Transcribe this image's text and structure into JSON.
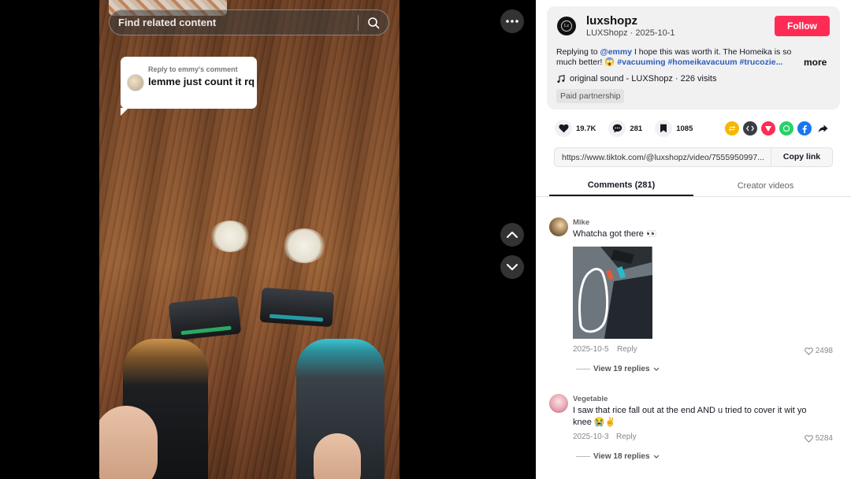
{
  "search": {
    "placeholder": "Find related content"
  },
  "reply_bubble": {
    "meta": "Reply to emmy's comment",
    "text": "lemme just count it rq"
  },
  "author": {
    "handle": "luxshopz",
    "sub": "LUXShopz · 2025-10-1",
    "follow_label": "Follow",
    "desc_prefix": "Replying to ",
    "desc_mention": "@emmy",
    "desc_body": " I hope this was worth it. The Homeika is so much better! 😱 ",
    "desc_tags": "#vacuuming #homeikavacuum #trucozie...",
    "more_label": "more",
    "music": "original sound - LUXShopz · 226 visits",
    "badge": "Paid partnership"
  },
  "stats": {
    "likes": "19.7K",
    "comments": "281",
    "saves": "1085"
  },
  "share_icons": [
    {
      "name": "repost-icon",
      "color": "#f5b700"
    },
    {
      "name": "embed-icon",
      "color": "#3b3d45"
    },
    {
      "name": "send-icon",
      "color": "#fe2c55"
    },
    {
      "name": "whatsapp-icon",
      "color": "#25d366"
    },
    {
      "name": "facebook-icon",
      "color": "#1877f2"
    },
    {
      "name": "share-arrow-icon",
      "color": "#161823"
    }
  ],
  "link": {
    "url": "https://www.tiktok.com/@luxshopz/video/7555950997...",
    "copy_label": "Copy link"
  },
  "tabs": {
    "comments": "Comments (281)",
    "creator": "Creator videos"
  },
  "comments": [
    {
      "user": "Mike",
      "text": "Whatcha got there 👀",
      "date": "2025-10-5",
      "reply": "Reply",
      "likes": "2498",
      "view": "View 19 replies"
    },
    {
      "user": "Vegetable",
      "text": "I saw that rice fall out at the end AND u tried to cover it wit yo knee 😭✌️",
      "date": "2025-10-3",
      "reply": "Reply",
      "likes": "5284",
      "view": "View 18 replies"
    }
  ]
}
